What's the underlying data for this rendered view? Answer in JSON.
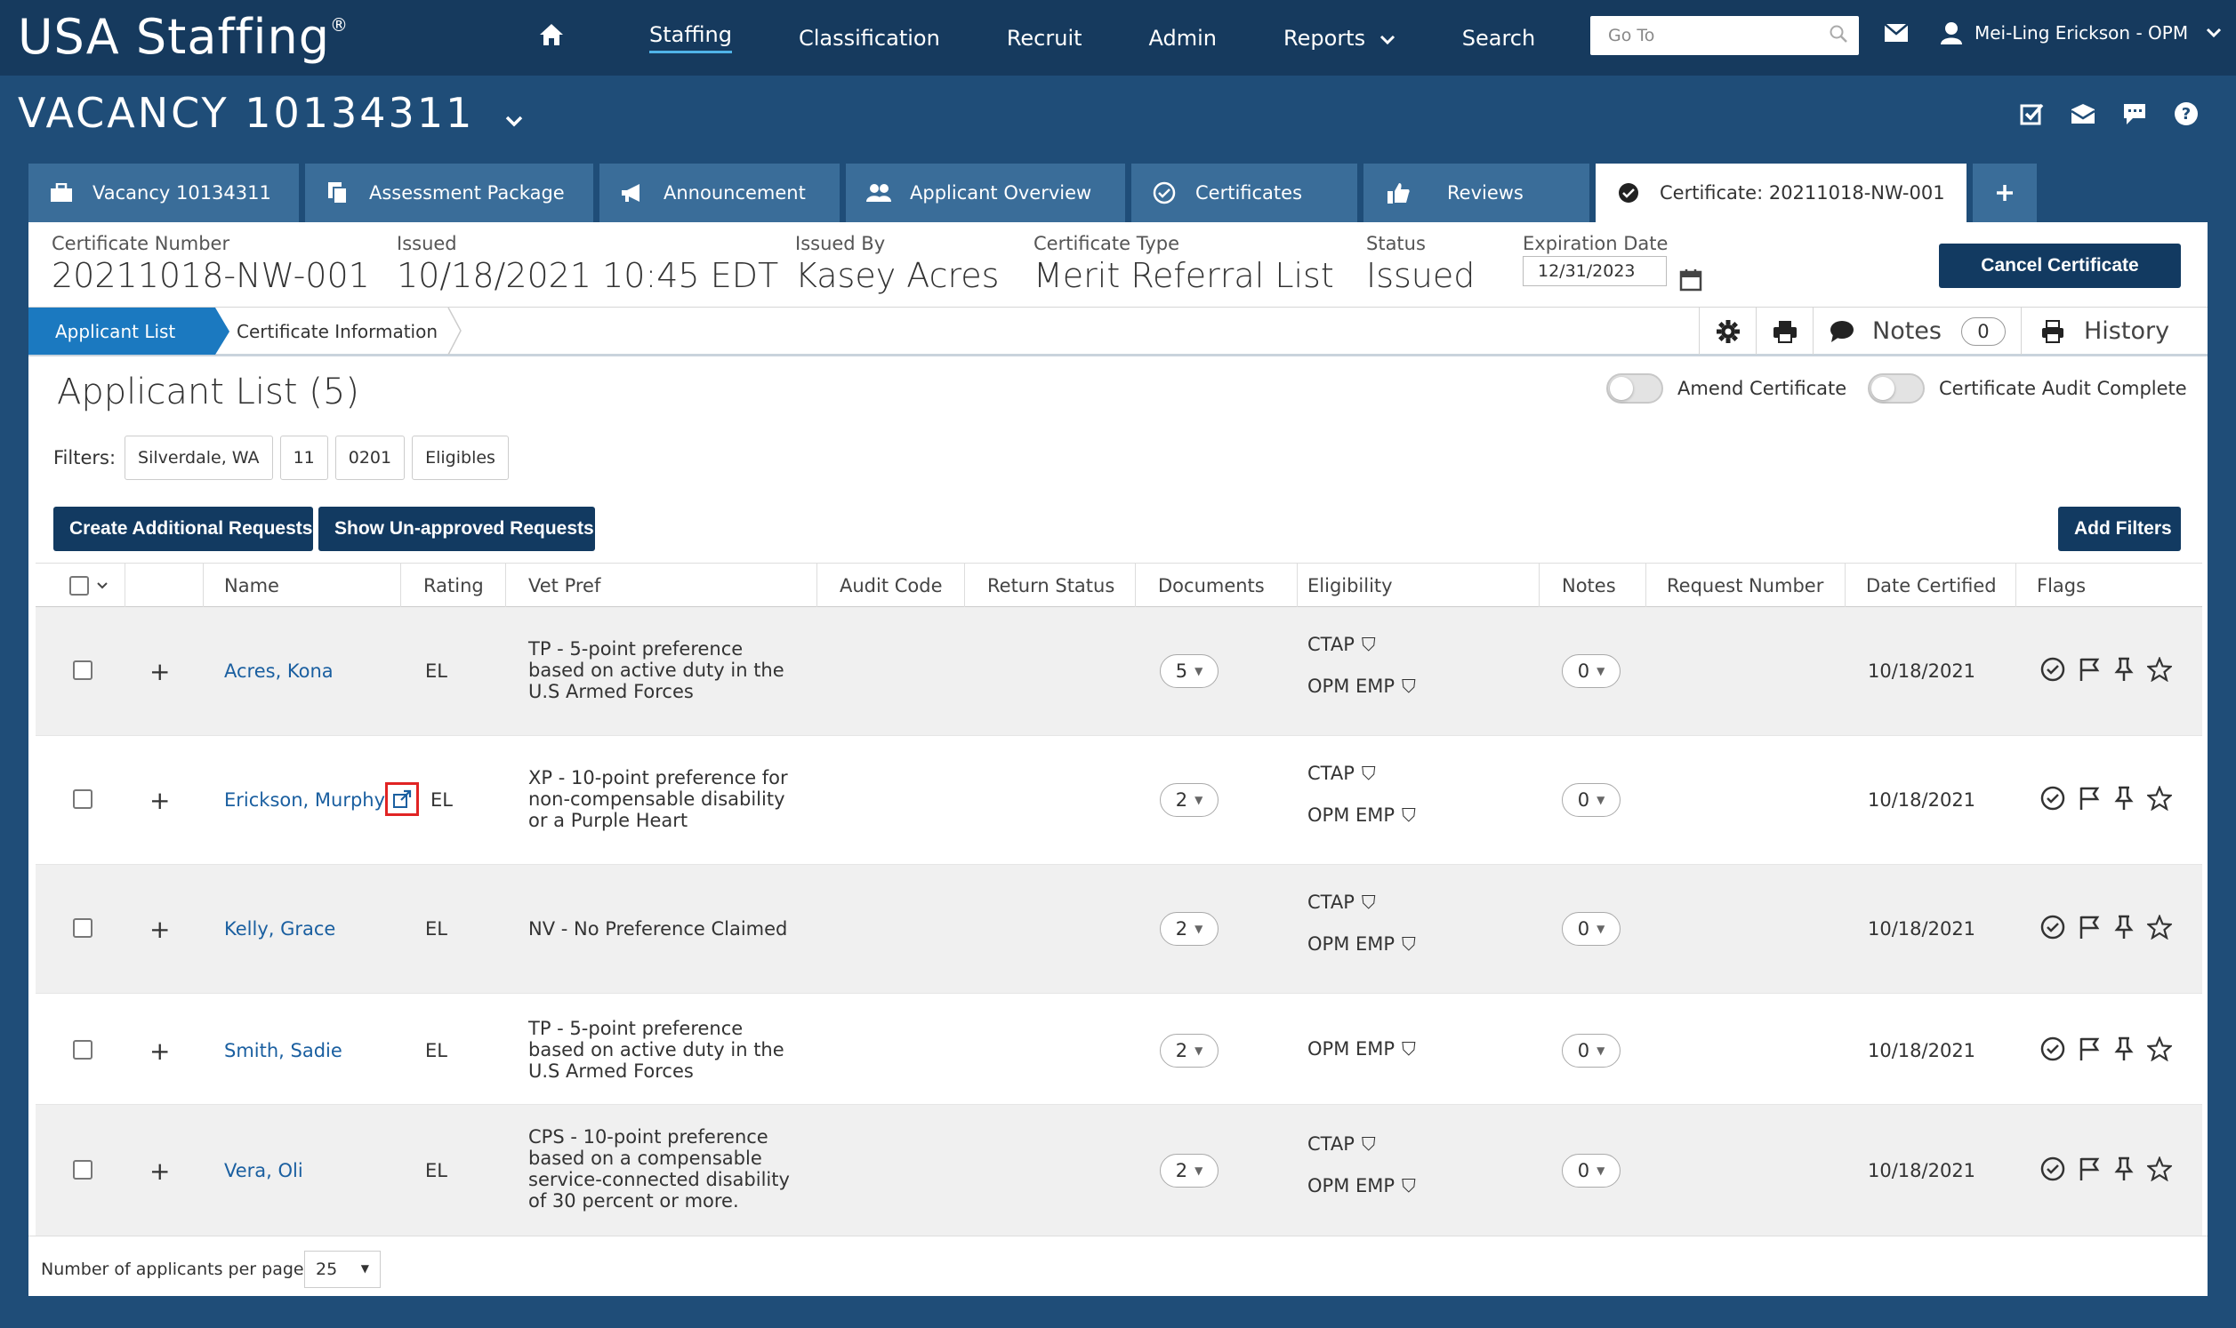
{
  "app": {
    "logo": "USA Staffing",
    "logo_mark": "®"
  },
  "nav": {
    "home_icon": "home-icon",
    "items": [
      {
        "label": "Staffing",
        "active": true
      },
      {
        "label": "Classification"
      },
      {
        "label": "Recruit"
      },
      {
        "label": "Admin"
      },
      {
        "label": "Reports"
      },
      {
        "label": "Search"
      }
    ],
    "goto_placeholder": "Go To",
    "user": "Mei-Ling Erickson - OPM"
  },
  "vacancy": {
    "title": "VACANCY 10134311"
  },
  "tabs": [
    {
      "label": "Vacancy 10134311"
    },
    {
      "label": "Assessment Package"
    },
    {
      "label": "Announcement"
    },
    {
      "label": "Applicant Overview"
    },
    {
      "label": "Certificates"
    },
    {
      "label": "Reviews"
    },
    {
      "label": "Certificate: 20211018-NW-001",
      "active": true
    }
  ],
  "certificate": {
    "number_label": "Certificate Number",
    "number": "20211018-NW-001",
    "issued_label": "Issued",
    "issued": "10/18/2021 10:45 EDT",
    "issued_by_label": "Issued By",
    "issued_by": "Kasey Acres",
    "type_label": "Certificate Type",
    "type": "Merit Referral List",
    "status_label": "Status",
    "status": "Issued",
    "expiration_label": "Expiration Date",
    "expiration": "12/31/2023",
    "cancel_label": "Cancel Certificate"
  },
  "subtabs": {
    "active": "Applicant List",
    "second": "Certificate Information",
    "notes_label": "Notes",
    "notes_count": "0",
    "history_label": "History"
  },
  "list": {
    "title": "Applicant List (5)",
    "amend_label": "Amend Certificate",
    "audit_label": "Certificate Audit Complete",
    "filters_label": "Filters:",
    "filters": [
      "Silverdale, WA",
      "11",
      "0201",
      "Eligibles"
    ],
    "create_btn": "Create Additional Requests",
    "show_btn": "Show Un-approved Requests",
    "add_filters_btn": "Add Filters"
  },
  "table": {
    "headers": [
      "Name",
      "Rating",
      "Vet Pref",
      "Audit Code",
      "Return Status",
      "Documents",
      "Eligibility",
      "Notes",
      "Request Number",
      "Date Certified",
      "Flags"
    ],
    "rows": [
      {
        "name": "Acres, Kona",
        "rating": "EL",
        "vet": "TP - 5-point preference based on active duty in the U.S Armed Forces",
        "docs": "5",
        "elig": [
          "CTAP",
          "OPM EMP"
        ],
        "notes": "0",
        "date": "10/18/2021"
      },
      {
        "name": "Erickson, Murphy",
        "rating": "EL",
        "vet": "XP - 10-point preference for non-compensable disability or a Purple Heart",
        "docs": "2",
        "elig": [
          "CTAP",
          "OPM EMP"
        ],
        "notes": "0",
        "date": "10/18/2021"
      },
      {
        "name": "Kelly, Grace",
        "rating": "EL",
        "vet": "NV - No Preference Claimed",
        "docs": "2",
        "elig": [
          "CTAP",
          "OPM EMP"
        ],
        "notes": "0",
        "date": "10/18/2021"
      },
      {
        "name": "Smith, Sadie",
        "rating": "EL",
        "vet": "TP - 5-point preference based on active duty in the U.S Armed Forces",
        "docs": "2",
        "elig": [
          "OPM EMP"
        ],
        "notes": "0",
        "date": "10/18/2021"
      },
      {
        "name": "Vera, Oli",
        "rating": "EL",
        "vet": "CPS - 10-point preference based on a compensable service-connected disability of 30 percent or more.",
        "docs": "2",
        "elig": [
          "CTAP",
          "OPM EMP"
        ],
        "notes": "0",
        "date": "10/18/2021"
      }
    ]
  },
  "footer": {
    "per_page_label": "Number of applicants per page:",
    "per_page": "25"
  }
}
